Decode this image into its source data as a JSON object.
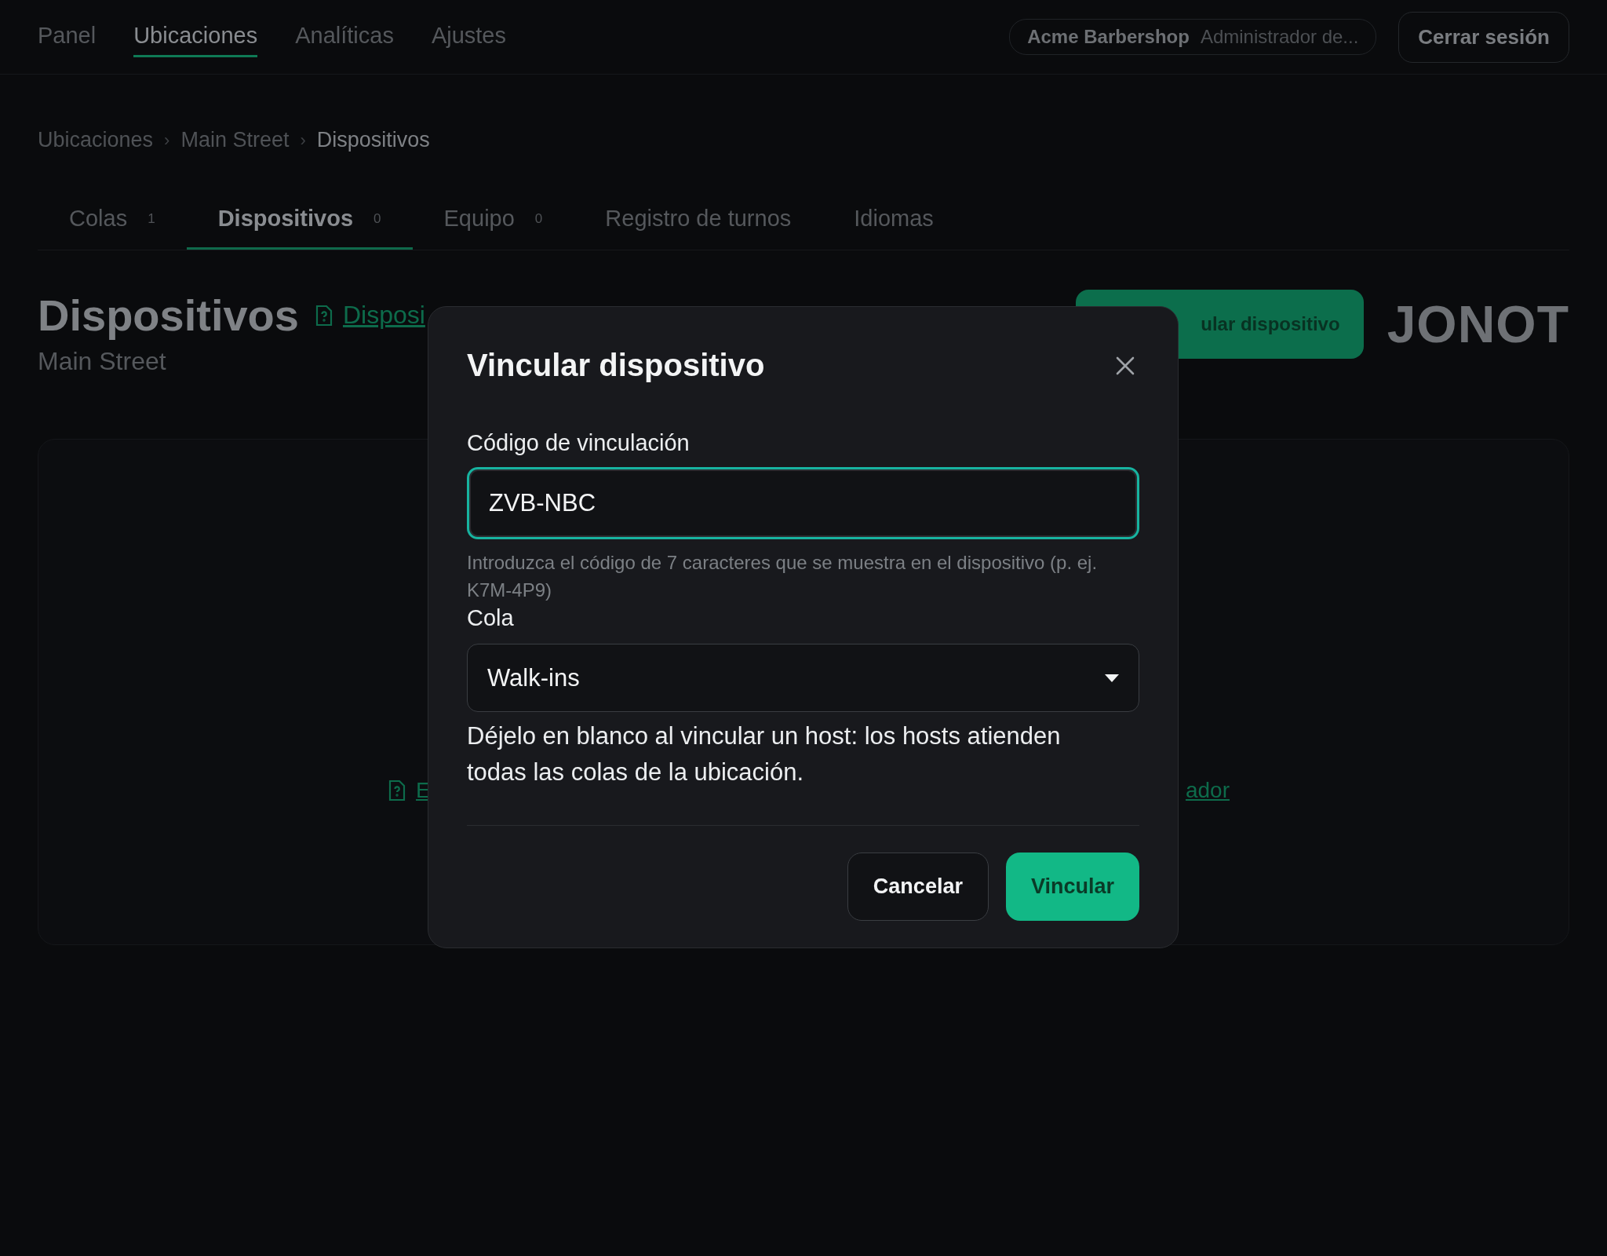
{
  "nav": {
    "items": [
      {
        "label": "Panel",
        "selected": false
      },
      {
        "label": "Ubicaciones",
        "selected": true
      },
      {
        "label": "Analíticas",
        "selected": false
      },
      {
        "label": "Ajustes",
        "selected": false
      }
    ],
    "account": {
      "business": "Acme Barbershop",
      "role": "Administrador de..."
    },
    "logout": "Cerrar sesión"
  },
  "breadcrumb": [
    {
      "label": "Ubicaciones",
      "current": false
    },
    {
      "label": "Main Street",
      "current": false
    },
    {
      "label": "Dispositivos",
      "current": true
    }
  ],
  "breadcrumb_separator": "›",
  "tabs": [
    {
      "label": "Colas",
      "count": "1",
      "selected": false
    },
    {
      "label": "Dispositivos",
      "count": "0",
      "selected": true
    },
    {
      "label": "Equipo",
      "count": "0",
      "selected": false
    },
    {
      "label": "Registro de turnos",
      "selected": false
    },
    {
      "label": "Idiomas",
      "selected": false
    }
  ],
  "header": {
    "title": "Dispositivos",
    "help_link": "Disposi",
    "subtitle": "Main Street",
    "primary_button": "ular dispositivo",
    "logo": "JONOT"
  },
  "card": {
    "left_link": "E",
    "right_link": "ador"
  },
  "dialog": {
    "title": "Vincular dispositivo",
    "code": {
      "label": "Código de vinculación",
      "value": "ZVB-NBC",
      "focused": true,
      "hint": "Introduzca el código de 7 caracteres que se muestra en el dispositivo (p. ej. K7M-4P9)"
    },
    "queue": {
      "label": "Cola",
      "value": "Walk-ins",
      "note": "Déjelo en blanco al vincular un host: los hosts atienden todas las colas de la ubicación."
    },
    "buttons": [
      {
        "label": "Cancelar",
        "kind": "secondary"
      },
      {
        "label": "Vincular",
        "kind": "primary"
      }
    ]
  }
}
